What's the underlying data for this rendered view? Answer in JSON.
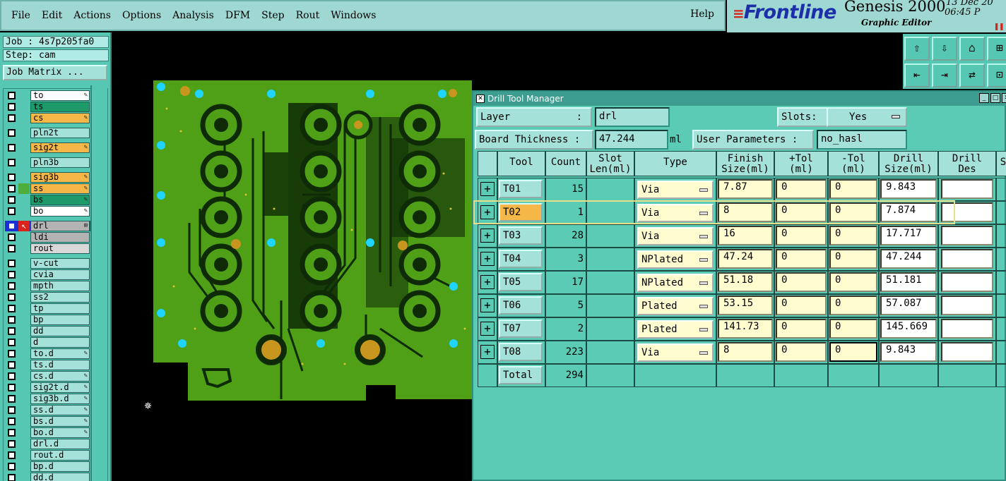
{
  "menu": {
    "items": [
      "File",
      "Edit",
      "Actions",
      "Options",
      "Analysis",
      "DFM",
      "Step",
      "Rout",
      "Windows"
    ],
    "help": "Help"
  },
  "brand": {
    "logo": "Frontline",
    "product": "Genesis 2000",
    "subtitle": "Graphic Editor",
    "date": "13 Dec 20",
    "time": "06:45 P"
  },
  "job": {
    "job_label": "Job : 4s7p205fa0",
    "step_label": "Step: cam",
    "matrix_button": "Job Matrix ..."
  },
  "layers": [
    {
      "name": "to",
      "color": "#ffffff",
      "flag": "✎"
    },
    {
      "name": "ts",
      "color": "#1c9a6a",
      "flag": ""
    },
    {
      "name": "cs",
      "color": "#f6b749",
      "flag": "✎"
    },
    {
      "name": "pln2t",
      "color": "#a4e2d9",
      "flag": ""
    },
    {
      "name": "sig2t",
      "color": "#f6b749",
      "flag": "✎"
    },
    {
      "name": "pln3b",
      "color": "#a4e2d9",
      "flag": ""
    },
    {
      "name": "sig3b",
      "color": "#f6b749",
      "flag": "✎"
    },
    {
      "name": "ss",
      "color": "#f6b749",
      "flag": "✎",
      "marker": "#4dae3e"
    },
    {
      "name": "bs",
      "color": "#1c9a6a",
      "flag": "✎"
    },
    {
      "name": "bo",
      "color": "#ffffff",
      "flag": "✎"
    },
    {
      "name": "drl",
      "color": "#b3b3b3",
      "flag": "⊞",
      "active": true
    },
    {
      "name": "ldi",
      "color": "#b3b3b3",
      "flag": ""
    },
    {
      "name": "rout",
      "color": "#d8d8d8",
      "flag": ""
    },
    {
      "name": "v-cut",
      "color": "#a4e2d9",
      "flag": ""
    },
    {
      "name": "cvia",
      "color": "#a4e2d9",
      "flag": ""
    },
    {
      "name": "mpth",
      "color": "#a4e2d9",
      "flag": ""
    },
    {
      "name": "ss2",
      "color": "#a4e2d9",
      "flag": ""
    },
    {
      "name": "tp",
      "color": "#a4e2d9",
      "flag": ""
    },
    {
      "name": "bp",
      "color": "#a4e2d9",
      "flag": ""
    },
    {
      "name": "dd",
      "color": "#a4e2d9",
      "flag": ""
    },
    {
      "name": "d",
      "color": "#a4e2d9",
      "flag": ""
    },
    {
      "name": "to.d",
      "color": "#a4e2d9",
      "flag": "✎"
    },
    {
      "name": "ts.d",
      "color": "#a4e2d9",
      "flag": ""
    },
    {
      "name": "cs.d",
      "color": "#a4e2d9",
      "flag": "✎"
    },
    {
      "name": "sig2t.d",
      "color": "#a4e2d9",
      "flag": "✎"
    },
    {
      "name": "sig3b.d",
      "color": "#a4e2d9",
      "flag": "✎"
    },
    {
      "name": "ss.d",
      "color": "#a4e2d9",
      "flag": "✎"
    },
    {
      "name": "bs.d",
      "color": "#a4e2d9",
      "flag": "✎"
    },
    {
      "name": "bo.d",
      "color": "#a4e2d9",
      "flag": "✎"
    },
    {
      "name": "drl.d",
      "color": "#a4e2d9",
      "flag": ""
    },
    {
      "name": "rout.d",
      "color": "#a4e2d9",
      "flag": ""
    },
    {
      "name": "bp.d",
      "color": "#a4e2d9",
      "flag": ""
    },
    {
      "name": "dd.d",
      "color": "#a4e2d9",
      "flag": ""
    }
  ],
  "dtm": {
    "title": "Drill Tool Manager",
    "layer_label": "Layer",
    "layer_colon": ":",
    "layer_value": "drl",
    "slots_label": "Slots:",
    "slots_value": "Yes",
    "thickness_label": "Board Thickness :",
    "thickness_value": "47.244",
    "thickness_unit": "ml",
    "user_params_label": "User Parameters :",
    "user_params_value": "no_hasl",
    "headers": {
      "tool": "Tool",
      "count": "Count",
      "slot_len_1": "Slot",
      "slot_len_2": "Len(ml)",
      "type": "Type",
      "finish_1": "Finish",
      "finish_2": "Size(ml)",
      "ptol_1": "+Tol",
      "ptol_2": "(ml)",
      "mtol_1": "-Tol",
      "mtol_2": "(ml)",
      "drill_1": "Drill",
      "drill_2": "Size(ml)",
      "des_1": "Drill",
      "des_2": "Des",
      "extra": "S"
    },
    "rows": [
      {
        "tool": "T01",
        "count": "15",
        "type": "Via",
        "finish": "7.87",
        "ptol": "0",
        "mtol": "0",
        "drill": "9.843"
      },
      {
        "tool": "T02",
        "count": "1",
        "type": "Via",
        "finish": "8",
        "ptol": "0",
        "mtol": "0",
        "drill": "7.874"
      },
      {
        "tool": "T03",
        "count": "28",
        "type": "Via",
        "finish": "16",
        "ptol": "0",
        "mtol": "0",
        "drill": "17.717"
      },
      {
        "tool": "T04",
        "count": "3",
        "type": "NPlated",
        "finish": "47.24",
        "ptol": "0",
        "mtol": "0",
        "drill": "47.244"
      },
      {
        "tool": "T05",
        "count": "17",
        "type": "NPlated",
        "finish": "51.18",
        "ptol": "0",
        "mtol": "0",
        "drill": "51.181"
      },
      {
        "tool": "T06",
        "count": "5",
        "type": "Plated",
        "finish": "53.15",
        "ptol": "0",
        "mtol": "0",
        "drill": "57.087"
      },
      {
        "tool": "T07",
        "count": "2",
        "type": "Plated",
        "finish": "141.73",
        "ptol": "0",
        "mtol": "0",
        "drill": "145.669"
      },
      {
        "tool": "T08",
        "count": "223",
        "type": "Via",
        "finish": "8",
        "ptol": "0",
        "mtol": "0",
        "drill": "9.843"
      }
    ],
    "total_label": "Total",
    "total_count": "294"
  }
}
